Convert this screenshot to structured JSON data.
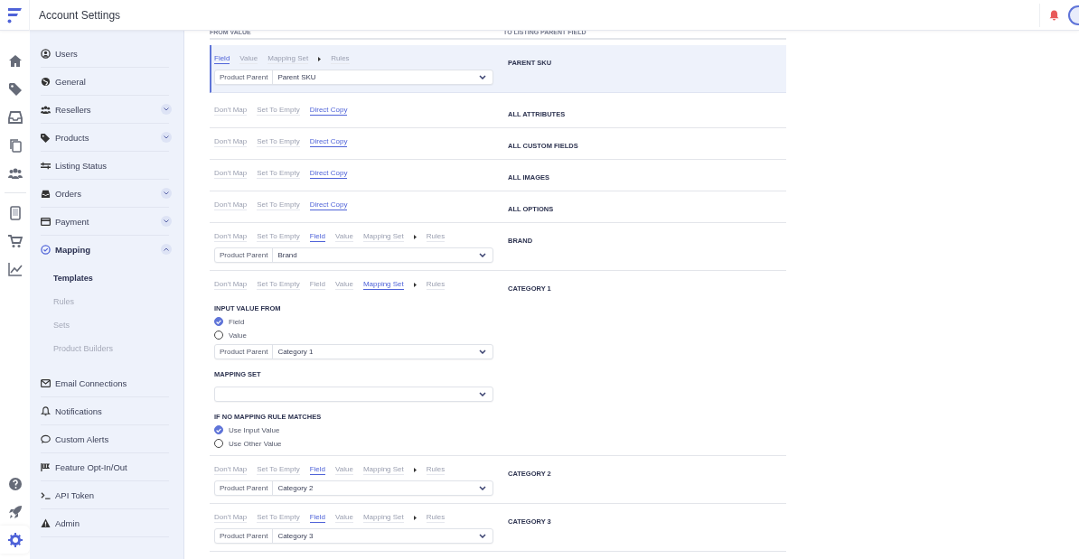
{
  "topbar": {
    "title": "Account Settings"
  },
  "rail": {
    "top": [
      {
        "selected": false
      },
      {
        "selected": false
      },
      {
        "selected": false
      },
      {
        "selected": false
      },
      {
        "selected": false
      },
      {
        "selected": false
      },
      {
        "selected": false
      },
      {
        "selected": false
      }
    ],
    "bottom": [
      {
        "selected": false
      },
      {
        "selected": false
      },
      {
        "selected": true
      }
    ]
  },
  "sidebar": {
    "items": [
      {
        "label": "Users",
        "selected": false
      },
      {
        "label": "General",
        "selected": false
      },
      {
        "label": "Resellers",
        "selected": false,
        "expanded": false
      },
      {
        "label": "Products",
        "selected": false,
        "expanded": false
      },
      {
        "label": "Listing Status",
        "selected": false
      },
      {
        "label": "Orders",
        "selected": false,
        "expanded": false
      },
      {
        "label": "Payment",
        "selected": false,
        "expanded": false
      },
      {
        "label": "Mapping",
        "selected": true,
        "expanded": true,
        "children": [
          {
            "label": "Templates",
            "selected": true
          },
          {
            "label": "Rules",
            "selected": false
          },
          {
            "label": "Sets",
            "selected": false
          },
          {
            "label": "Product Builders",
            "selected": false
          }
        ]
      },
      {
        "label": "Email Connections",
        "selected": false
      },
      {
        "label": "Notifications",
        "selected": false
      },
      {
        "label": "Custom Alerts",
        "selected": false
      },
      {
        "label": "Feature Opt-In/Out",
        "selected": false
      },
      {
        "label": "API Token",
        "selected": false
      },
      {
        "label": "Admin",
        "selected": false
      }
    ]
  },
  "mapping": {
    "columns": [
      "FROM VALUE",
      "TO LISTING PARENT FIELD"
    ],
    "rows": [
      {
        "target": "PARENT SKU",
        "highlighted": true,
        "options": [
          {
            "label": "Field",
            "selected": true
          },
          {
            "label": "Value",
            "selected": false
          },
          {
            "label": "Mapping Set",
            "selected": false,
            "arrow_after": true
          },
          {
            "label": "Rules",
            "selected": false
          }
        ],
        "select": {
          "prefix": "Product Parent",
          "value": "Parent SKU"
        }
      },
      {
        "target": "ALL ATTRIBUTES",
        "highlighted": false,
        "options": [
          {
            "label": "Don't Map",
            "selected": false
          },
          {
            "label": "Set To Empty",
            "selected": false
          },
          {
            "label": "Direct Copy",
            "selected": true
          }
        ]
      },
      {
        "target": "ALL CUSTOM FIELDS",
        "highlighted": false,
        "options": [
          {
            "label": "Don't Map",
            "selected": false
          },
          {
            "label": "Set To Empty",
            "selected": false
          },
          {
            "label": "Direct Copy",
            "selected": true
          }
        ]
      },
      {
        "target": "ALL IMAGES",
        "highlighted": false,
        "options": [
          {
            "label": "Don't Map",
            "selected": false
          },
          {
            "label": "Set To Empty",
            "selected": false
          },
          {
            "label": "Direct Copy",
            "selected": true
          }
        ]
      },
      {
        "target": "ALL OPTIONS",
        "highlighted": false,
        "options": [
          {
            "label": "Don't Map",
            "selected": false
          },
          {
            "label": "Set To Empty",
            "selected": false
          },
          {
            "label": "Direct Copy",
            "selected": true
          }
        ]
      },
      {
        "target": "BRAND",
        "highlighted": false,
        "options": [
          {
            "label": "Don't Map",
            "selected": false
          },
          {
            "label": "Set To Empty",
            "selected": false
          },
          {
            "label": "Field",
            "selected": true
          },
          {
            "label": "Value",
            "selected": false
          },
          {
            "label": "Mapping Set",
            "selected": false,
            "arrow_after": true
          },
          {
            "label": "Rules",
            "selected": false
          }
        ],
        "select": {
          "prefix": "Product Parent",
          "value": "Brand"
        }
      },
      {
        "target": "CATEGORY 1",
        "highlighted": false,
        "options": [
          {
            "label": "Don't Map",
            "selected": false
          },
          {
            "label": "Set To Empty",
            "selected": false
          },
          {
            "label": "Field",
            "selected": false
          },
          {
            "label": "Value",
            "selected": false
          },
          {
            "label": "Mapping Set",
            "selected": true,
            "arrow_after": true
          },
          {
            "label": "Rules",
            "selected": false
          }
        ],
        "details": {
          "input_title": "INPUT VALUE FROM",
          "input_radios": [
            {
              "label": "Field",
              "selected": true
            },
            {
              "label": "Value",
              "selected": false
            }
          ],
          "select": {
            "prefix": "Product Parent",
            "value": "Category 1"
          },
          "mapping_set_title": "MAPPING SET",
          "fallback_title": "IF NO MAPPING RULE MATCHES",
          "fallback_radios": [
            {
              "label": "Use Input Value",
              "selected": true
            },
            {
              "label": "Use Other Value",
              "selected": false
            }
          ]
        }
      },
      {
        "target": "CATEGORY 2",
        "highlighted": false,
        "options": [
          {
            "label": "Don't Map",
            "selected": false
          },
          {
            "label": "Set To Empty",
            "selected": false
          },
          {
            "label": "Field",
            "selected": true
          },
          {
            "label": "Value",
            "selected": false
          },
          {
            "label": "Mapping Set",
            "selected": false,
            "arrow_after": true
          },
          {
            "label": "Rules",
            "selected": false
          }
        ],
        "select": {
          "prefix": "Product Parent",
          "value": "Category 2"
        }
      },
      {
        "target": "CATEGORY 3",
        "highlighted": false,
        "options": [
          {
            "label": "Don't Map",
            "selected": false
          },
          {
            "label": "Set To Empty",
            "selected": false
          },
          {
            "label": "Field",
            "selected": true
          },
          {
            "label": "Value",
            "selected": false
          },
          {
            "label": "Mapping Set",
            "selected": false,
            "arrow_after": true
          },
          {
            "label": "Rules",
            "selected": false
          }
        ],
        "select": {
          "prefix": "Product Parent",
          "value": "Category 3"
        }
      }
    ]
  }
}
